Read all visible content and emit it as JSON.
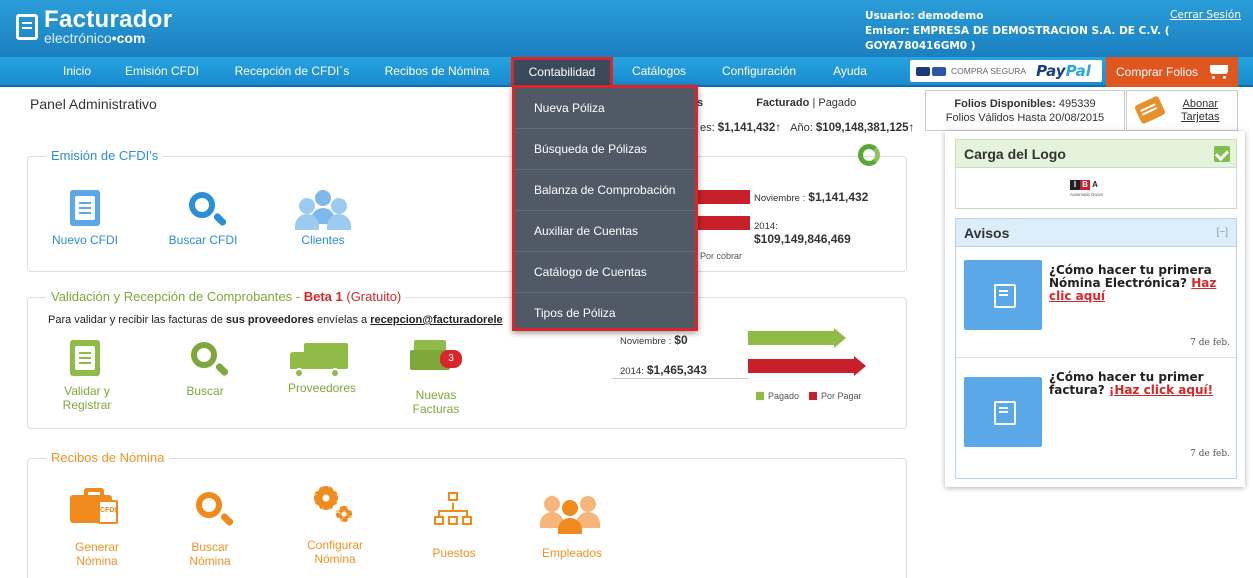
{
  "header": {
    "logo_title": "Facturador",
    "logo_sub_pre": "electrónico",
    "logo_sub_post": "•com",
    "user_label": "Usuario:",
    "user_value": "demodemo",
    "emisor_label": "Emisor:",
    "emisor_value": "EMPRESA DE DEMOSTRACION S.A. DE C.V. ( GOYA780416GM0 )",
    "logout": "Cerrar Sesión"
  },
  "nav": {
    "items": [
      "Inicio",
      "Emisión CFDI",
      "Recepción de CFDI´s",
      "Recibos de Nómina",
      "Contabilidad",
      "Catálogos",
      "Configuración",
      "Ayuda"
    ],
    "active": "Contabilidad",
    "compra_segura": "COMPRA SEGURA",
    "paypal_1": "Pay",
    "paypal_2": "Pal",
    "buy_button": "Comprar Folios"
  },
  "dropdown": {
    "items": [
      "Nueva Póliza",
      "Búsqueda de Pólizas",
      "Balanza de Comprobación",
      "Auxiliar de Cuentas",
      "Catálogo de Cuentas",
      "Tipos de Póliza"
    ]
  },
  "panel_title": "Panel Administrativo",
  "stats": {
    "header_letter": "s",
    "facturado": "Facturado",
    "pagado": "| Pagado",
    "mes_label": "es:",
    "mes_value": "$1,141,432↑",
    "anio_label": "Año:",
    "anio_value": "$109,148,381,125↑"
  },
  "folios": {
    "disponibles_label": "Folios Disponibles:",
    "disponibles_value": "495339",
    "validos": "Folios Válidos Hasta 20/08/2015"
  },
  "abonar": {
    "line1": "Abonar",
    "line2": "Tarjetas"
  },
  "emision": {
    "legend": "Emisión de CFDI's",
    "tiles": [
      "Nuevo CFDI",
      "Buscar CFDI",
      "Clientes"
    ],
    "chart": {
      "nov_label": "Noviembre :",
      "nov_value": "$1,141,432",
      "year_label": "2014:",
      "year_value": "$109,149,846,469",
      "por_cobrar": "Por cobrar"
    }
  },
  "validacion": {
    "legend_pre": "Validación y Recepción de Comprobantes -",
    "legend_beta": "Beta 1",
    "legend_post": "(Gratuito)",
    "info_pre": "Para validar y recibir las facturas de",
    "info_bold": "sus proveedores",
    "info_mid": "envíelas a",
    "info_email": "recepcion@facturadorele",
    "tiles": [
      "Validar y Registrar",
      "Buscar",
      "Proveedores",
      "Nuevas Facturas"
    ],
    "badge": "3",
    "chart": {
      "nov_label": "Noviembre :",
      "nov_value": "$0",
      "year_label": "2014:",
      "year_value": "$1,465,343",
      "legend_pagado": "Pagado",
      "legend_por_pagar": "Por Pagar"
    }
  },
  "nomina": {
    "legend": "Recibos de Nómina",
    "tiles": [
      "Generar Nómina",
      "Buscar Nómina",
      "Configurar Nómina",
      "Puestos",
      "Empleados"
    ],
    "cfdi_tag": "CFDI"
  },
  "logo_widget": {
    "title": "Carga del Logo",
    "iba": [
      "I",
      "B",
      "A"
    ],
    "iba_sub": "Automatic Doors"
  },
  "avisos": {
    "title": "Avisos",
    "min": "[−]",
    "items": [
      {
        "text": "¿Cómo hacer tu primera Nómina Electrónica?",
        "link": "Haz clic aquí",
        "date": "7 de feb."
      },
      {
        "text": "¿Cómo hacer tu primer factura?",
        "link": "¡Haz click aquí!",
        "date": "7 de feb."
      }
    ]
  },
  "colors": {
    "brand_blue": "#1b8fd5",
    "accent_red": "#d8262a",
    "buy_orange": "#e0561f",
    "green": "#7fa83a",
    "orange": "#f2931f"
  }
}
